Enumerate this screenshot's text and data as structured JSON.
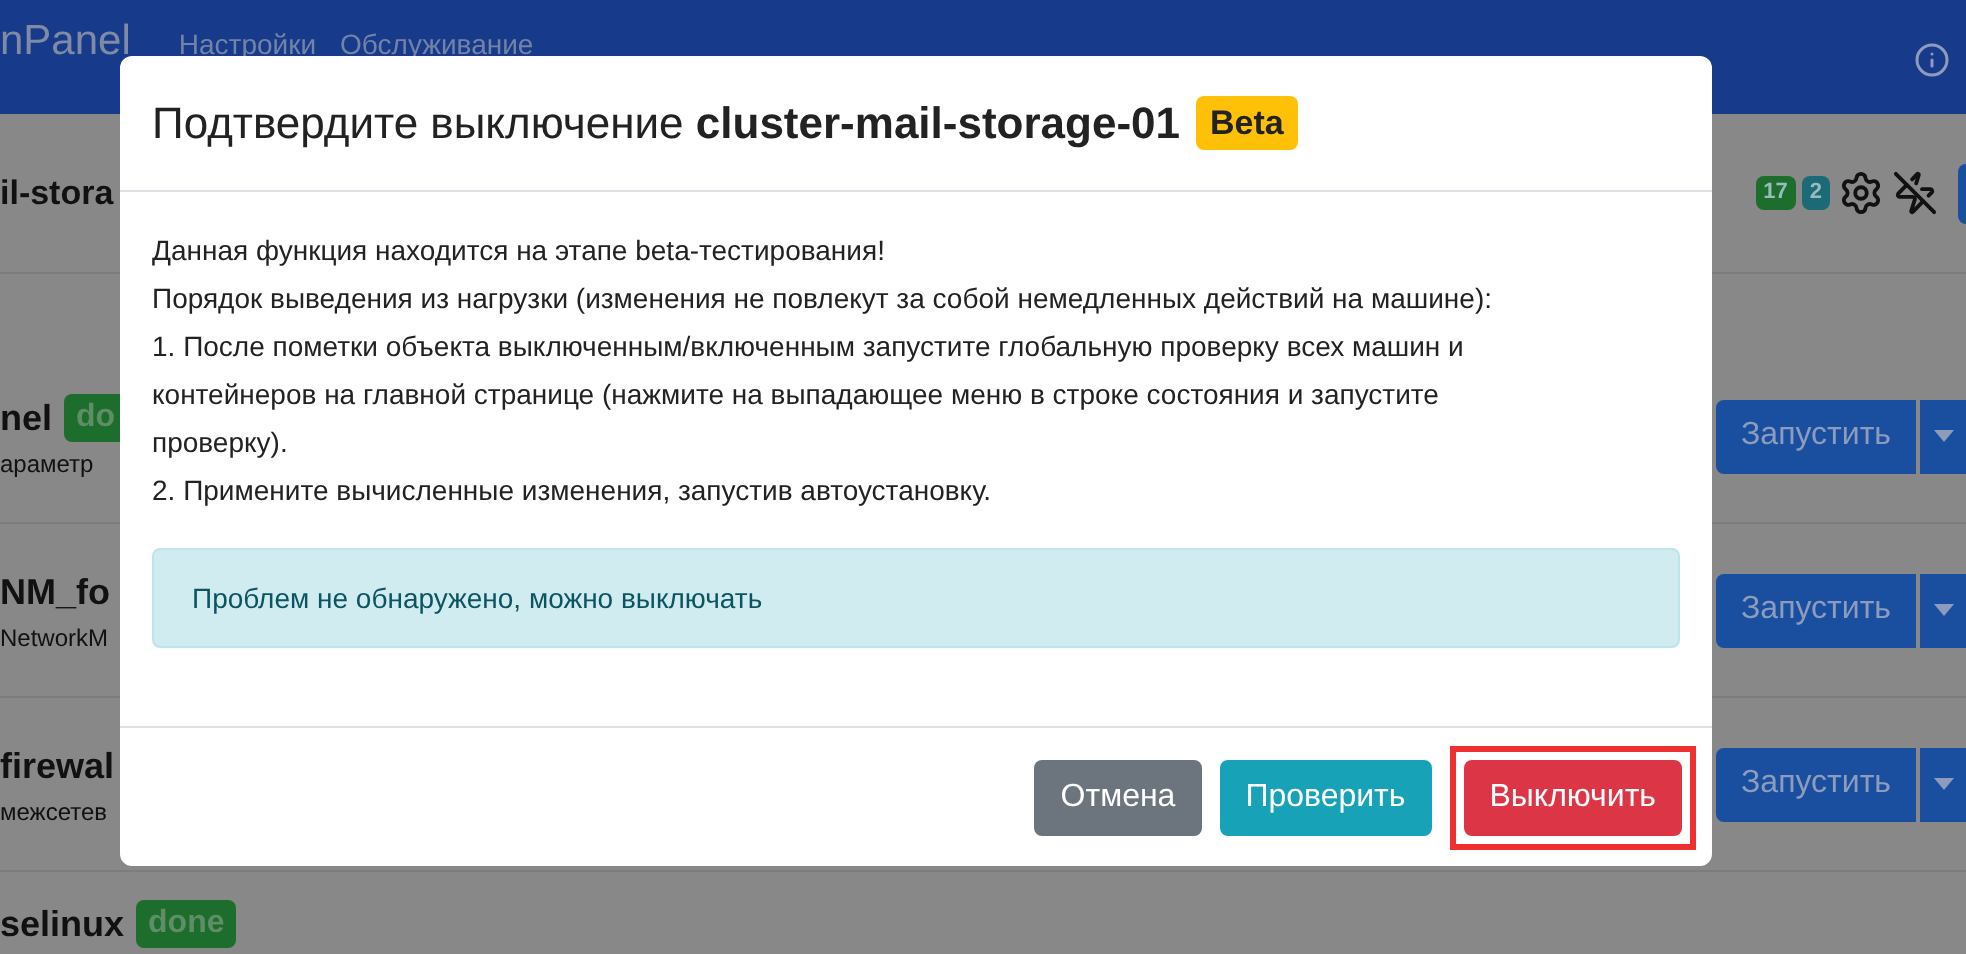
{
  "navbar": {
    "brand": "nPanel",
    "links": [
      "Настройки",
      "Обслуживание"
    ]
  },
  "header": {
    "title": "il-stora",
    "badges": [
      {
        "text": "17",
        "color": "#1d6e2d"
      },
      {
        "text": "2",
        "color": "#1b6a76"
      }
    ]
  },
  "rows": [
    {
      "title": "nel",
      "status": "do",
      "subtitle": "араметр",
      "button": "Запустить"
    },
    {
      "title": "NM_fo",
      "subtitle": "NetworkM",
      "button": "Запустить"
    },
    {
      "title": "firewal",
      "subtitle": "межсетев",
      "button": "Запустить"
    },
    {
      "title": "selinux",
      "status": "done"
    }
  ],
  "modal": {
    "title": "Подтвердите выключение **cluster-mail-storage-01**",
    "badge": "Beta",
    "body": [
      "Данная функция находится на этапе beta-тестирования!",
      "Порядок выведения из нагрузки (изменения не повлекут за собой немедленных действий на машине):",
      "1. После пометки объекта выключенным/включенным запустите глобальную проверку всех машин и контейнеров на главной странице (нажмите на выпадающее меню в строке состояния и запустите проверку).",
      "2. Примените вычисленные изменения, запустив автоустановку."
    ],
    "alert": "Проблем не обнаружено, можно выключать",
    "buttons": [
      {
        "label": "Отмена",
        "kind": "secondary",
        "highlighted": false
      },
      {
        "label": "Проверить",
        "kind": "info",
        "highlighted": false
      },
      {
        "label": "Выключить",
        "kind": "danger",
        "highlighted": true
      }
    ]
  }
}
